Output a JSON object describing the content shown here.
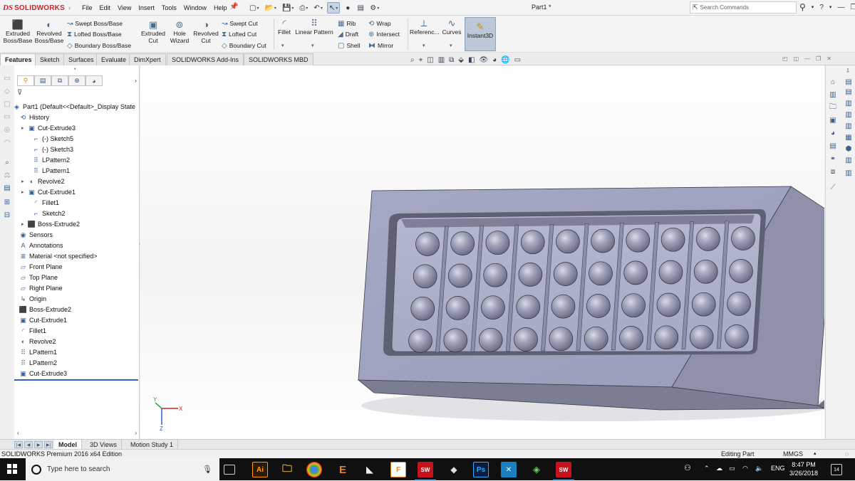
{
  "app": {
    "brand_mark": "DS",
    "brand_word": "SOLIDWORKS",
    "document_title": "Part1 *"
  },
  "menu": [
    "File",
    "Edit",
    "View",
    "Insert",
    "Tools",
    "Window",
    "Help"
  ],
  "search": {
    "placeholder": "Search Commands"
  },
  "ribbon": {
    "extruded_boss": "Extruded\nBoss/Base",
    "revolved_boss": "Revolved\nBoss/Base",
    "swept_boss": "Swept Boss/Base",
    "lofted_boss": "Lofted Boss/Base",
    "boundary_boss": "Boundary Boss/Base",
    "extruded_cut": "Extruded\nCut",
    "hole_wizard": "Hole\nWizard",
    "revolved_cut": "Revolved\nCut",
    "swept_cut": "Swept Cut",
    "lofted_cut": "Lofted Cut",
    "boundary_cut": "Boundary Cut",
    "fillet": "Fillet",
    "linear_pattern": "Linear Pattern",
    "rib": "Rib",
    "draft": "Draft",
    "shell": "Shell",
    "wrap": "Wrap",
    "intersect": "Intersect",
    "mirror": "Mirror",
    "reference": "Referenc...",
    "curves": "Curves",
    "instant3d": "Instant3D"
  },
  "command_tabs": [
    "Features",
    "Sketch",
    "Surfaces",
    "Evaluate",
    "DimXpert",
    "SOLIDWORKS Add-Ins",
    "SOLIDWORKS MBD"
  ],
  "tree": {
    "root": "Part1  (Default<<Default>_Display State",
    "items": [
      {
        "label": "History",
        "icon": "history-icon"
      },
      {
        "label": "Cut-Extrude3",
        "icon": "cut-extrude-icon"
      },
      {
        "label": "(-) Sketch5",
        "icon": "sketch-icon"
      },
      {
        "label": "(-) Sketch3",
        "icon": "sketch-icon"
      },
      {
        "label": "LPattern2",
        "icon": "linear-pattern-icon"
      },
      {
        "label": "LPattern1",
        "icon": "linear-pattern-icon"
      },
      {
        "label": "Revolve2",
        "icon": "revolve-icon"
      },
      {
        "label": "Cut-Extrude1",
        "icon": "cut-extrude-icon"
      },
      {
        "label": "Fillet1",
        "icon": "fillet-icon"
      },
      {
        "label": "Sketch2",
        "icon": "sketch-icon"
      },
      {
        "label": "Boss-Extrude2",
        "icon": "boss-extrude-icon"
      },
      {
        "label": "Sensors",
        "icon": "sensors-icon"
      },
      {
        "label": "Annotations",
        "icon": "annotations-icon"
      },
      {
        "label": "Material <not specified>",
        "icon": "material-icon"
      },
      {
        "label": "Front Plane",
        "icon": "plane-icon"
      },
      {
        "label": "Top Plane",
        "icon": "plane-icon"
      },
      {
        "label": "Right Plane",
        "icon": "plane-icon"
      },
      {
        "label": "Origin",
        "icon": "origin-icon"
      },
      {
        "label": "Boss-Extrude2",
        "icon": "boss-extrude-icon"
      },
      {
        "label": "Cut-Extrude1",
        "icon": "cut-extrude-icon"
      },
      {
        "label": "Fillet1",
        "icon": "fillet-icon"
      },
      {
        "label": "Revolve2",
        "icon": "revolve-icon"
      },
      {
        "label": "LPattern1",
        "icon": "linear-pattern-icon"
      },
      {
        "label": "LPattern2",
        "icon": "linear-pattern-icon"
      },
      {
        "label": "Cut-Extrude3",
        "icon": "cut-extrude-icon"
      }
    ]
  },
  "model": {
    "rows": 4,
    "columns": 10,
    "triad": {
      "x": "X",
      "y": "Y",
      "z": "Z"
    }
  },
  "bottom_tabs": [
    "Model",
    "3D Views",
    "Motion Study 1"
  ],
  "status": {
    "edition": "SOLIDWORKS Premium 2016 x64 Edition",
    "mode": "Editing Part",
    "units": "MMGS"
  },
  "taskbar": {
    "search_placeholder": "Type here to search",
    "language": "ENG",
    "time": "8:47 PM",
    "date": "3/26/2018",
    "notification_count": "14",
    "apps": [
      "Ai",
      "E",
      "Ps",
      "SW"
    ]
  }
}
